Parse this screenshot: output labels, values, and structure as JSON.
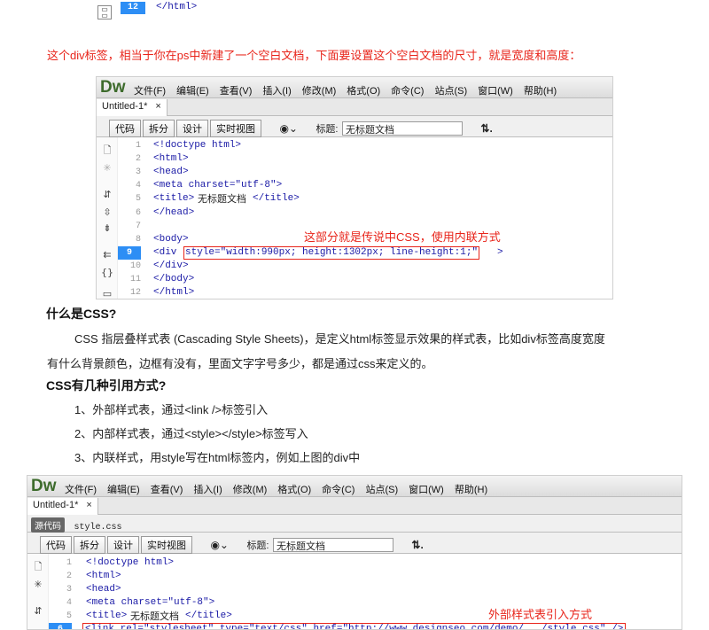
{
  "top_fragment": {
    "line_no": "12",
    "code": "</html>"
  },
  "intro_red": "这个div标签，相当于你在ps中新建了一个空白文档，下面要设置这个空白文档的尺寸，就是宽度和高度：",
  "dw1": {
    "logo": "Dw",
    "menu": [
      "文件(F)",
      "编辑(E)",
      "查看(V)",
      "插入(I)",
      "修改(M)",
      "格式(O)",
      "命令(C)",
      "站点(S)",
      "窗口(W)",
      "帮助(H)"
    ],
    "tab": "Untitled-1*",
    "tab_close": "×",
    "view_buttons": [
      "代码",
      "拆分",
      "设计",
      "实时视图"
    ],
    "title_label": "标题:",
    "title_value": "无标题文档",
    "line_numbers": [
      "1",
      "2",
      "3",
      "4",
      "5",
      "6",
      "7",
      "8",
      "9",
      "10",
      "11",
      "12"
    ],
    "code_lines": [
      "<!doctype html>",
      "<html>",
      "<head>",
      "<meta charset=\"utf-8\">",
      "<title>",
      "</head>",
      "",
      "<body>",
      "<div ",
      "</div>",
      "</body>",
      "</html>"
    ],
    "title_text": "无标题文档",
    "title_close": "</title>",
    "div_attr": "style=\"width:990px; height:1302px; line-height:1;\"",
    "div_close": ">",
    "annotation": "这部分就是传说中CSS，使用内联方式"
  },
  "q1": "什么是CSS?",
  "p1a": "CSS 指层叠样式表 (Cascading Style Sheets)，是定义html标签显示效果的样式表，比如div标签高度宽度",
  "p1b": "有什么背景颜色，边框有没有，里面文字字号多少，都是通过css来定义的。",
  "q2": "CSS有几种引用方式?",
  "list": [
    "1、外部样式表，通过<link />标签引入",
    "2、内部样式表，通过<style></style>标签写入",
    "3、内联样式，用style写在html标签内，例如上图的div中"
  ],
  "dw2": {
    "logo": "Dw",
    "menu": [
      "文件(F)",
      "编辑(E)",
      "查看(V)",
      "插入(I)",
      "修改(M)",
      "格式(O)",
      "命令(C)",
      "站点(S)",
      "窗口(W)",
      "帮助(H)"
    ],
    "tab": "Untitled-1*",
    "tab_close": "×",
    "source_btn": "源代码",
    "source_file": "style.css",
    "view_buttons": [
      "代码",
      "拆分",
      "设计",
      "实时视图"
    ],
    "title_label": "标题:",
    "title_value": "无标题文档",
    "line_numbers": [
      "1",
      "2",
      "3",
      "4",
      "5",
      "6"
    ],
    "code_lines": [
      "<!doctype html>",
      "<html>",
      "<head>",
      "<meta charset=\"utf-8\">",
      "<title>",
      "<link rel=\"stylesheet\" type=\"text/css\" href=\"http://www.designseo.com/demo/.../style.css\" />"
    ],
    "title_text": "无标题文档",
    "title_close": "</title>",
    "annotation": "外部样式表引入方式"
  }
}
